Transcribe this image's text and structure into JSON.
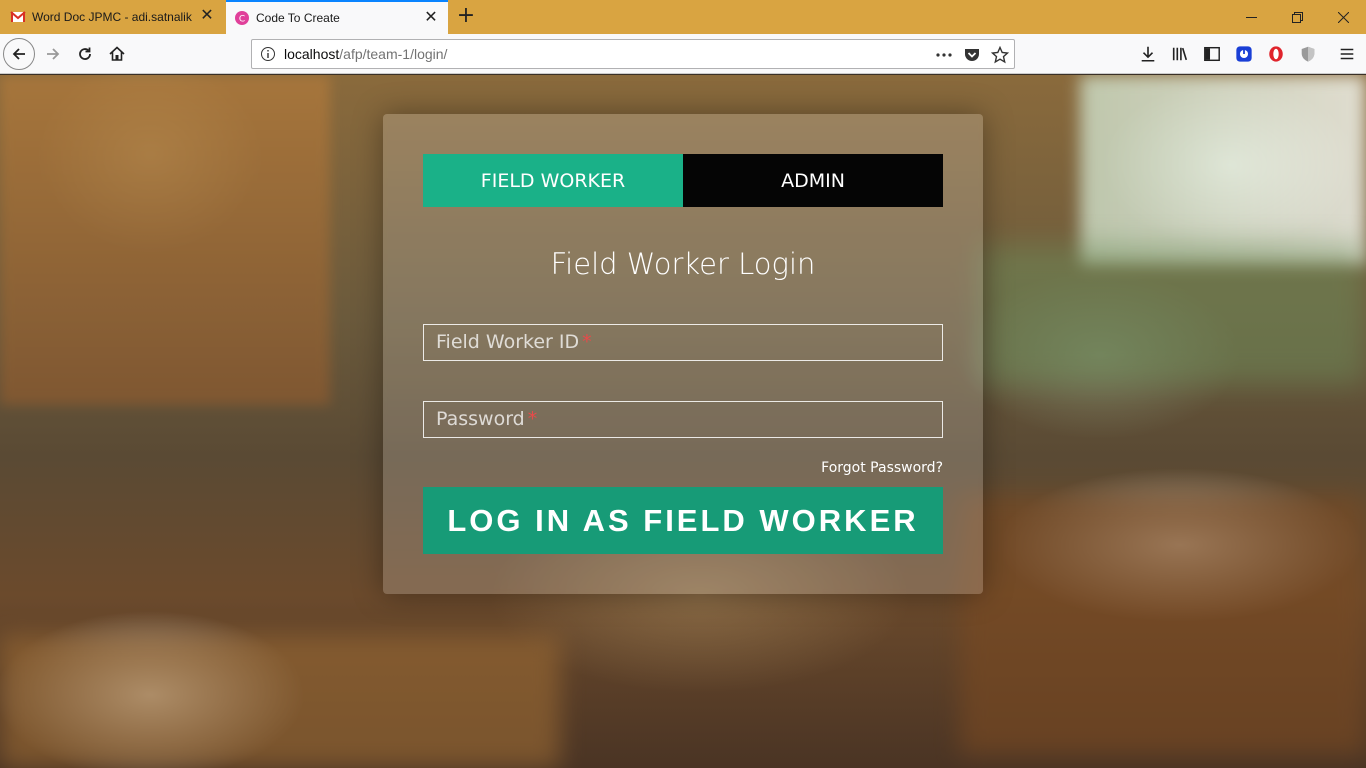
{
  "browser": {
    "tabs": [
      {
        "title": "Word Doc JPMC - adi.satnalika"
      },
      {
        "title": "Code To Create"
      }
    ],
    "url": {
      "host": "localhost",
      "path": "/afp/team-1/login/"
    }
  },
  "login": {
    "tabs": {
      "field_worker": "FIELD WORKER",
      "admin": "ADMIN"
    },
    "title": "Field Worker Login",
    "id_placeholder": "Field Worker ID",
    "password_placeholder": "Password",
    "required_mark": "*",
    "forgot": "Forgot Password?",
    "submit": "LOG IN AS FIELD WORKER"
  },
  "colors": {
    "accent": "#1ab188",
    "accent_dark": "#179b77",
    "titlebar": "#d9a441",
    "required": "#e84a4a"
  },
  "icons": [
    "gmail-icon",
    "codetocreate-icon",
    "info-icon",
    "more-icon",
    "pocket-icon",
    "star-icon",
    "download-icon",
    "library-icon",
    "sidebar-icon",
    "extension-icon",
    "opera-icon",
    "shield-icon",
    "menu-icon"
  ]
}
